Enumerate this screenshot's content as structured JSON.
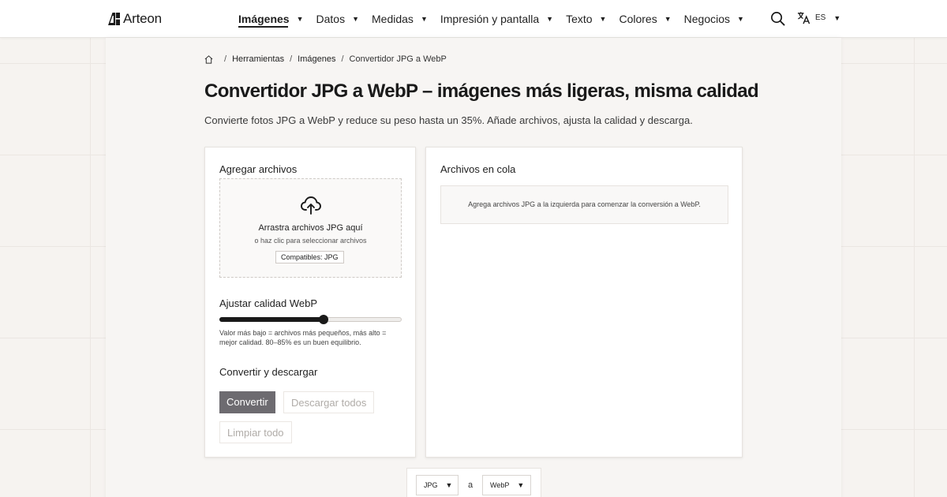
{
  "brand": {
    "name": "Arteon",
    "logo_icon": "arteon-logo-icon"
  },
  "nav": {
    "items": [
      {
        "label": "Imágenes",
        "active": true
      },
      {
        "label": "Datos",
        "active": false
      },
      {
        "label": "Medidas",
        "active": false
      },
      {
        "label": "Impresión y pantalla",
        "active": false
      },
      {
        "label": "Texto",
        "active": false
      },
      {
        "label": "Colores",
        "active": false
      },
      {
        "label": "Negocios",
        "active": false
      }
    ],
    "caret": "▼",
    "search_icon": "search-icon",
    "language": {
      "icon": "translate-icon",
      "label": "ES",
      "caret": "▼"
    }
  },
  "breadcrumb": {
    "home_icon": "home-icon",
    "separator": "/",
    "items": [
      "Herramientas",
      "Imágenes"
    ],
    "current": "Convertidor JPG a WebP"
  },
  "page": {
    "title": "Convertidor JPG a WebP – imágenes más ligeras, misma calidad",
    "subtitle": "Convierte fotos JPG a WebP y reduce su peso hasta un 35%. Añade archivos, ajusta la calidad y descarga."
  },
  "upload": {
    "section_title": "Agregar archivos",
    "dropzone_title": "Arrastra archivos JPG aquí",
    "dropzone_sub": "o haz clic para seleccionar archivos",
    "badge": "Compatibles: JPG",
    "icon": "cloud-upload-icon"
  },
  "quality": {
    "section_title": "Ajustar calidad WebP",
    "value_fraction": 0.57,
    "hint": "Valor más bajo = archivos más pequeños, más alto = mejor calidad. 80–85% es un buen equilibrio."
  },
  "actions": {
    "section_title": "Convertir y descargar",
    "convert_label": "Convertir",
    "download_all_label": "Descargar todos",
    "clear_all_label": "Limpiar todo"
  },
  "queue": {
    "title": "Archivos en cola",
    "empty_message": "Agrega archivos JPG a la izquierda para comenzar la conversión a WebP."
  },
  "format": {
    "from": "JPG",
    "to_word": "a",
    "to": "WebP",
    "caret": "▼"
  },
  "colors": {
    "primary_button": "#6d6b70",
    "text": "#1f1f1f",
    "background": "#f6f3f0"
  }
}
